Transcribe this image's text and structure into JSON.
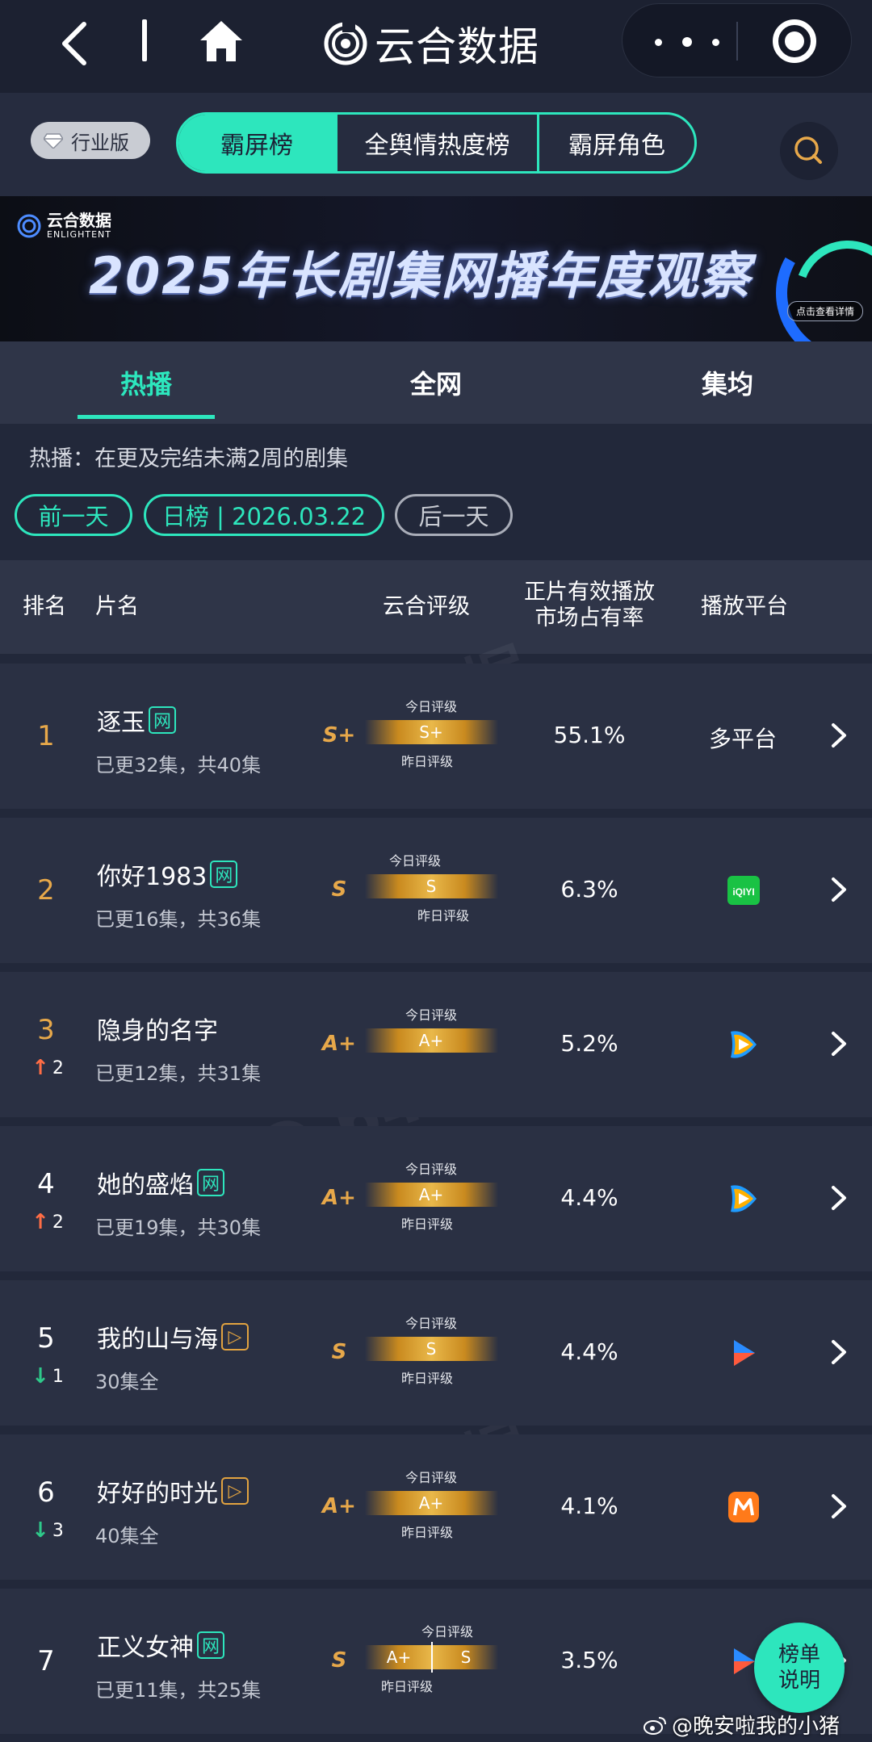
{
  "app": {
    "title": "云合数据"
  },
  "toolbar": {
    "edition": "行业版"
  },
  "rank_tabs": [
    "霸屏榜",
    "全舆情热度榜",
    "霸屏角色"
  ],
  "banner": {
    "brand_cn": "云合数据",
    "brand_en": "ENLIGHTENT",
    "title": "2025年长剧集网播年度观察",
    "detail_link": "点击查看详情"
  },
  "sub_tabs": [
    "热播",
    "全网",
    "集均"
  ],
  "description": "热播：在更及完结未满2周的剧集",
  "date_nav": {
    "prev": "前一天",
    "current": "日榜 | 2026.03.22",
    "next": "后一天"
  },
  "table_headers": {
    "rank": "排名",
    "title": "片名",
    "rating": "云合评级",
    "share_line1": "正片有效播放",
    "share_line2": "市场占有率",
    "platform": "播放平台"
  },
  "rating_labels": {
    "today": "今日评级",
    "yesterday": "昨日评级"
  },
  "rows": [
    {
      "rank": "1",
      "change": "",
      "title": "逐玉",
      "tag": "网",
      "sub": "已更32集，共40集",
      "grade": "S+",
      "today": "S+",
      "yesterday": "",
      "share": "55.1%",
      "platform": "多平台",
      "platform_icon": "multi"
    },
    {
      "rank": "2",
      "change": "",
      "title": "你好1983",
      "tag": "网",
      "sub": "已更16集，共36集",
      "grade": "S",
      "today": "S",
      "yesterday": "",
      "share": "6.3%",
      "platform": "",
      "platform_icon": "iqiyi-icon"
    },
    {
      "rank": "3",
      "change": "2",
      "title": "隐身的名字",
      "tag": "",
      "sub": "已更12集，共31集",
      "grade": "A+",
      "today": "A+",
      "yesterday": "",
      "share": "5.2%",
      "platform": "",
      "platform_icon": "tencent-video-icon"
    },
    {
      "rank": "4",
      "change": "2",
      "title": "她的盛焰",
      "tag": "网",
      "sub": "已更19集，共30集",
      "grade": "A+",
      "today": "A+",
      "yesterday": "",
      "share": "4.4%",
      "platform": "",
      "platform_icon": "tencent-video-icon"
    },
    {
      "rank": "5",
      "change": "1",
      "title": "我的山与海",
      "tag": "▷",
      "sub": "30集全",
      "grade": "S",
      "today": "S",
      "yesterday": "",
      "share": "4.4%",
      "platform": "",
      "platform_icon": "youku-icon"
    },
    {
      "rank": "6",
      "change": "3",
      "title": "好好的时光",
      "tag": "▷",
      "sub": "40集全",
      "grade": "A+",
      "today": "A+",
      "yesterday": "",
      "share": "4.1%",
      "platform": "",
      "platform_icon": "mango-tv-icon"
    },
    {
      "rank": "7",
      "change": "",
      "title": "正义女神",
      "tag": "网",
      "sub": "已更11集，共25集",
      "grade": "S",
      "today": "S",
      "yesterday": "A+",
      "share": "3.5%",
      "platform": "",
      "platform_icon": "youku-icon"
    }
  ],
  "help_button": {
    "line1": "榜单",
    "line2": "说明"
  },
  "credit": "@晚安啦我的小猪",
  "watermark": {
    "text": "云合数据",
    "id": "@ 6441204"
  },
  "colors": {
    "accent": "#2de6bd",
    "gold": "#e7a84a",
    "up": "#ff6d45",
    "down": "#2ec98a",
    "bg": "#22283a"
  }
}
